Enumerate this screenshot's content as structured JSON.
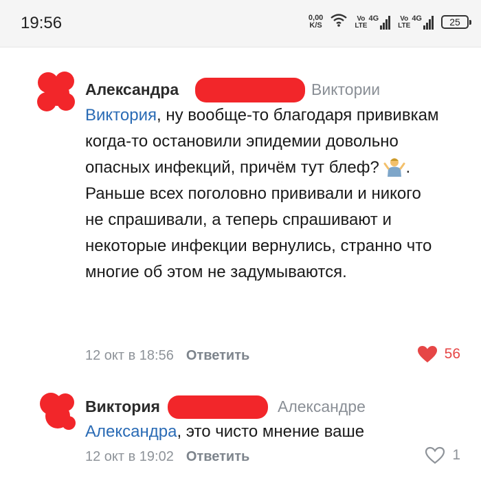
{
  "status_bar": {
    "time": "19:56",
    "net_speed_value": "0,00",
    "net_speed_unit": "K/S",
    "sim1_vo": "Vo",
    "sim1_lte": "LTE",
    "sim1_gen": "4G",
    "sim2_vo": "Vo",
    "sim2_lte": "LTE",
    "sim2_gen": "4G",
    "battery": "25"
  },
  "comments": [
    {
      "author": "Александра",
      "reply_to": "Виктории",
      "mention": "Виктория",
      "text_part1": ", ну вообще-то благодаря прививкам когда-то остановили эпидемии довольно опасных инфекций, причём тут блеф? ",
      "emoji": "person-shrugging",
      "text_part2": ". Раньше всех поголовно прививали и никого не спрашивали, а теперь спрашивают и некоторые инфекции вернулись, странно что многие об этом не задумываются.",
      "date": "12 окт в 18:56",
      "reply_label": "Ответить",
      "likes": "56",
      "liked": true,
      "like_color": "#e64646"
    },
    {
      "author": "Виктория",
      "reply_to": "Александре",
      "mention": "Александра",
      "text": ", это чисто мнение ваше",
      "date": "12 окт в 19:02",
      "reply_label": "Ответить",
      "likes": "1",
      "liked": false
    }
  ],
  "colors": {
    "mention": "#2a6bb5",
    "redaction": "#f2262a",
    "meta_gray": "#8e9399"
  }
}
